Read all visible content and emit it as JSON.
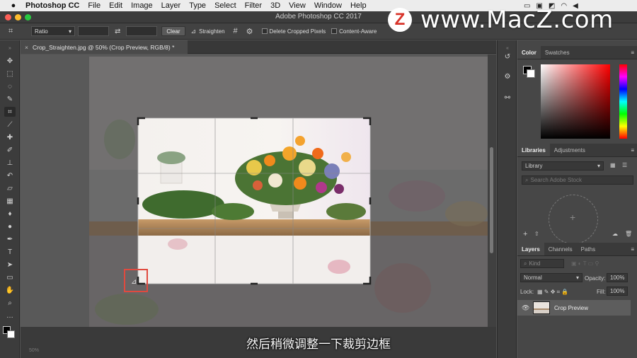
{
  "menubar": {
    "app_name": "Photoshop CC",
    "items": [
      "File",
      "Edit",
      "Image",
      "Layer",
      "Type",
      "Select",
      "Filter",
      "3D",
      "View",
      "Window",
      "Help"
    ]
  },
  "window": {
    "title": "Adobe Photoshop CC 2017"
  },
  "options_bar": {
    "ratio_value": "Ratio",
    "clear_label": "Clear",
    "straighten_label": "Straighten",
    "delete_cropped_label": "Delete Cropped Pixels",
    "content_aware_label": "Content-Aware"
  },
  "watermark": {
    "logo_letter": "Z",
    "text": "www.MacZ.com"
  },
  "document": {
    "tab_label": "Crop_Straighten.jpg @ 50% (Crop Preview, RGB/8) *",
    "zoom": "50%"
  },
  "panels": {
    "color_tabs": [
      "Color",
      "Swatches"
    ],
    "libraries_tabs": [
      "Libraries",
      "Adjustments"
    ],
    "library_select": "Library",
    "library_search_placeholder": "Search Adobe Stock",
    "layers_tabs": [
      "Layers",
      "Channels",
      "Paths"
    ],
    "kind_label": "Kind",
    "blend_mode": "Normal",
    "opacity_label": "Opacity:",
    "opacity_value": "100%",
    "lock_label": "Lock:",
    "fill_label": "Fill:",
    "fill_value": "100%",
    "layer_name": "Crop Preview"
  },
  "subtitle": "然后稍微调整一下裁剪边框",
  "colors": {
    "accent_red": "#e04a3f",
    "canvas_bg": "#595959"
  }
}
